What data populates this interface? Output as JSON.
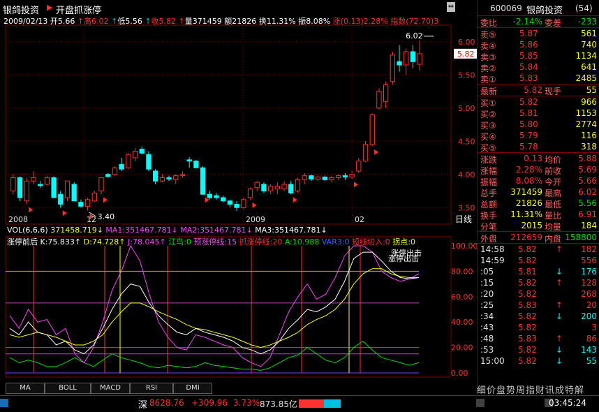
{
  "header": {
    "stock_name": "银鸽投资",
    "marker": "▶",
    "strategy": "开盘抓涨停"
  },
  "quote_line": {
    "date": "2009/02/13",
    "open": "开5.66",
    "high": "高6.02",
    "low": "低5.56",
    "close": "收5.82",
    "volume": "量371459",
    "amount": "额21826",
    "turnover": "换11.31%",
    "amplitude": "振8.08%",
    "change": "涨(0.13)2.28%",
    "index": "指数(72.70)3"
  },
  "chart_data": {
    "type": "candlestick",
    "price_axis": [
      6.0,
      5.5,
      5.0,
      4.5,
      4.0,
      3.5
    ],
    "current_price_tag": "5.82",
    "high_label": "6.02",
    "low_label": "3.40",
    "x_labels": [
      "2008",
      "12",
      "2009",
      "02"
    ],
    "candles": [
      {
        "o": 3.75,
        "h": 4.0,
        "l": 3.7,
        "c": 3.95,
        "up": true
      },
      {
        "o": 3.95,
        "h": 3.97,
        "l": 3.6,
        "c": 3.65,
        "up": false
      },
      {
        "o": 3.6,
        "h": 3.95,
        "l": 3.55,
        "c": 3.9,
        "up": true
      },
      {
        "o": 3.9,
        "h": 4.05,
        "l": 3.85,
        "c": 3.95,
        "up": true
      },
      {
        "o": 3.85,
        "h": 3.9,
        "l": 3.8,
        "c": 3.83,
        "up": false
      },
      {
        "o": 3.85,
        "h": 3.98,
        "l": 3.83,
        "c": 3.95,
        "up": true
      },
      {
        "o": 3.95,
        "h": 3.97,
        "l": 3.65,
        "c": 3.65,
        "up": false
      },
      {
        "o": 3.7,
        "h": 3.75,
        "l": 3.5,
        "c": 3.55,
        "up": false
      },
      {
        "o": 3.65,
        "h": 3.9,
        "l": 3.6,
        "c": 3.9,
        "up": true
      },
      {
        "o": 3.85,
        "h": 3.88,
        "l": 3.6,
        "c": 3.6,
        "up": false
      },
      {
        "o": 3.58,
        "h": 3.62,
        "l": 3.5,
        "c": 3.52,
        "up": false
      },
      {
        "o": 3.52,
        "h": 3.65,
        "l": 3.45,
        "c": 3.62,
        "up": true
      },
      {
        "o": 3.6,
        "h": 3.75,
        "l": 3.58,
        "c": 3.72,
        "up": true
      },
      {
        "o": 3.75,
        "h": 3.95,
        "l": 3.7,
        "c": 3.95,
        "up": true
      },
      {
        "o": 4.0,
        "h": 4.02,
        "l": 3.95,
        "c": 3.97,
        "up": false
      },
      {
        "o": 4.0,
        "h": 4.12,
        "l": 3.98,
        "c": 4.1,
        "up": true
      },
      {
        "o": 4.15,
        "h": 4.25,
        "l": 4.05,
        "c": 4.08,
        "up": false
      },
      {
        "o": 4.1,
        "h": 4.32,
        "l": 4.08,
        "c": 4.3,
        "up": true
      },
      {
        "o": 4.25,
        "h": 4.4,
        "l": 4.2,
        "c": 4.35,
        "up": true
      },
      {
        "o": 4.38,
        "h": 4.42,
        "l": 4.3,
        "c": 4.32,
        "up": false
      },
      {
        "o": 4.3,
        "h": 4.35,
        "l": 4.05,
        "c": 4.08,
        "up": false
      },
      {
        "o": 4.05,
        "h": 4.08,
        "l": 3.85,
        "c": 3.9,
        "up": false
      },
      {
        "o": 3.9,
        "h": 4.0,
        "l": 3.88,
        "c": 3.95,
        "up": true
      },
      {
        "o": 3.95,
        "h": 3.98,
        "l": 3.9,
        "c": 3.93,
        "up": false
      },
      {
        "o": 3.92,
        "h": 4.0,
        "l": 3.85,
        "c": 3.98,
        "up": true
      },
      {
        "o": 3.98,
        "h": 4.05,
        "l": 3.95,
        "c": 4.0,
        "up": true
      },
      {
        "o": 4.22,
        "h": 4.26,
        "l": 4.1,
        "c": 4.2,
        "up": false
      },
      {
        "o": 4.2,
        "h": 4.22,
        "l": 4.1,
        "c": 4.1,
        "up": false
      },
      {
        "o": 4.1,
        "h": 4.12,
        "l": 3.7,
        "c": 3.7,
        "up": false
      },
      {
        "o": 3.7,
        "h": 3.75,
        "l": 3.62,
        "c": 3.65,
        "up": false
      },
      {
        "o": 3.68,
        "h": 3.72,
        "l": 3.62,
        "c": 3.65,
        "up": false
      },
      {
        "o": 3.65,
        "h": 3.68,
        "l": 3.58,
        "c": 3.6,
        "up": false
      },
      {
        "o": 3.6,
        "h": 3.62,
        "l": 3.5,
        "c": 3.55,
        "up": false
      },
      {
        "o": 3.55,
        "h": 3.6,
        "l": 3.45,
        "c": 3.5,
        "up": false
      },
      {
        "o": 3.5,
        "h": 3.65,
        "l": 3.48,
        "c": 3.62,
        "up": true
      },
      {
        "o": 3.65,
        "h": 3.8,
        "l": 3.62,
        "c": 3.78,
        "up": true
      },
      {
        "o": 3.8,
        "h": 3.9,
        "l": 3.75,
        "c": 3.88,
        "up": true
      },
      {
        "o": 3.85,
        "h": 3.88,
        "l": 3.72,
        "c": 3.75,
        "up": false
      },
      {
        "o": 3.75,
        "h": 3.85,
        "l": 3.7,
        "c": 3.82,
        "up": true
      },
      {
        "o": 3.82,
        "h": 3.88,
        "l": 3.7,
        "c": 3.78,
        "up": true
      },
      {
        "o": 3.78,
        "h": 3.9,
        "l": 3.75,
        "c": 3.85,
        "up": true
      },
      {
        "o": 3.85,
        "h": 3.9,
        "l": 3.7,
        "c": 3.72,
        "up": false
      },
      {
        "o": 3.75,
        "h": 3.95,
        "l": 3.72,
        "c": 3.92,
        "up": true
      },
      {
        "o": 3.92,
        "h": 4.02,
        "l": 3.85,
        "c": 3.98,
        "up": true
      },
      {
        "o": 3.98,
        "h": 4.0,
        "l": 3.9,
        "c": 3.93,
        "up": false
      },
      {
        "o": 3.93,
        "h": 3.98,
        "l": 3.9,
        "c": 3.96,
        "up": true
      },
      {
        "o": 3.96,
        "h": 3.98,
        "l": 3.9,
        "c": 3.92,
        "up": false
      },
      {
        "o": 3.92,
        "h": 3.98,
        "l": 3.88,
        "c": 3.95,
        "up": true
      },
      {
        "o": 3.95,
        "h": 4.0,
        "l": 3.92,
        "c": 3.98,
        "up": true
      },
      {
        "o": 3.98,
        "h": 4.02,
        "l": 3.92,
        "c": 3.96,
        "up": false
      },
      {
        "o": 3.96,
        "h": 4.05,
        "l": 3.93,
        "c": 4.0,
        "up": true
      },
      {
        "o": 4.05,
        "h": 4.25,
        "l": 4.02,
        "c": 4.2,
        "up": true
      },
      {
        "o": 4.2,
        "h": 4.5,
        "l": 4.18,
        "c": 4.45,
        "up": true
      },
      {
        "o": 4.45,
        "h": 4.92,
        "l": 4.42,
        "c": 4.9,
        "up": true
      },
      {
        "o": 5.0,
        "h": 5.3,
        "l": 4.98,
        "c": 5.25,
        "up": true
      },
      {
        "o": 5.1,
        "h": 5.4,
        "l": 5.0,
        "c": 5.35,
        "up": true
      },
      {
        "o": 5.4,
        "h": 5.85,
        "l": 5.35,
        "c": 5.8,
        "up": true
      },
      {
        "o": 5.7,
        "h": 5.95,
        "l": 5.55,
        "c": 5.65,
        "up": false
      },
      {
        "o": 5.65,
        "h": 5.9,
        "l": 5.5,
        "c": 5.85,
        "up": true
      },
      {
        "o": 5.85,
        "h": 5.95,
        "l": 5.6,
        "c": 5.7,
        "up": false
      },
      {
        "o": 5.66,
        "h": 6.02,
        "l": 5.56,
        "c": 5.82,
        "up": true
      }
    ],
    "buy_signals": [
      2,
      7,
      11,
      13,
      28,
      35,
      41,
      50,
      53
    ]
  },
  "indicator_bar": {
    "vol": "VOL(6,6,6)",
    "vol_value": "371458.719",
    "ma1": "MA1:351467.781",
    "ma2": "MA2:351467.781",
    "ma3": "MA3:351467.781"
  },
  "kdj_bar": {
    "name": "涨停前后",
    "k": "K:75.833",
    "d": "D:74.728",
    "j": "J:78.045",
    "a": "江鸟:0",
    "b": "预涨停线:15",
    "c": "抓涨停线:20",
    "d2": "A:10.988",
    "e": "VAR3:0",
    "f": "短线切入:0",
    "g": "拐点:0"
  },
  "indicator_axis": [
    "100.00",
    "80.00",
    "60.00",
    "40.00",
    "20.00",
    "0.00"
  ],
  "indicator_notes": [
    "涨停出击",
    "涨停出击"
  ],
  "indicator_lines": {
    "k": [
      35,
      30,
      40,
      32,
      30,
      22,
      25,
      18,
      15,
      22,
      35,
      50,
      62,
      70,
      68,
      55,
      45,
      38,
      32,
      30,
      35,
      32,
      30,
      28,
      25,
      20,
      18,
      15,
      18,
      25,
      35,
      42,
      50,
      48,
      52,
      58,
      72,
      90,
      95,
      95,
      88,
      80,
      75,
      74,
      75
    ],
    "d": [
      30,
      28,
      30,
      32,
      30,
      28,
      25,
      22,
      22,
      25,
      30,
      40,
      48,
      55,
      55,
      52,
      48,
      45,
      42,
      38,
      35,
      34,
      32,
      30,
      28,
      25,
      22,
      20,
      22,
      25,
      28,
      32,
      38,
      42,
      45,
      50,
      58,
      70,
      78,
      82,
      82,
      78,
      76,
      75,
      75
    ],
    "j": [
      45,
      35,
      50,
      40,
      42,
      30,
      35,
      15,
      8,
      20,
      40,
      65,
      80,
      100,
      88,
      62,
      40,
      28,
      20,
      18,
      30,
      28,
      25,
      22,
      20,
      12,
      8,
      5,
      12,
      30,
      48,
      60,
      70,
      58,
      62,
      75,
      92,
      105,
      100,
      95,
      80,
      75,
      72,
      74,
      78
    ],
    "a": [
      12,
      8,
      10,
      8,
      5,
      5,
      8,
      12,
      8,
      5,
      10,
      15,
      12,
      10,
      8,
      5,
      4,
      6,
      5,
      4,
      5,
      8,
      6,
      5,
      4,
      3,
      3,
      2,
      4,
      8,
      12,
      14,
      20,
      15,
      10,
      8,
      12,
      20,
      25,
      18,
      12,
      10,
      8,
      6,
      8
    ]
  },
  "right_panel": {
    "code": "600069",
    "name": "银鸽投资",
    "count": "(54)",
    "ratio_label": "委比",
    "ratio_value": "-2.14%",
    "diff_label": "委差",
    "diff_value": "-233",
    "sells": [
      {
        "label": "卖⑤",
        "price": "5.87",
        "vol": "561"
      },
      {
        "label": "卖④",
        "price": "5.86",
        "vol": "740"
      },
      {
        "label": "卖③",
        "price": "5.85",
        "vol": "1134"
      },
      {
        "label": "卖②",
        "price": "5.84",
        "vol": "641"
      },
      {
        "label": "卖①",
        "price": "5.83",
        "vol": "2485"
      }
    ],
    "last_label": "最新",
    "last_value": "5.82",
    "hand_label": "现手",
    "hand_value": "55",
    "buys": [
      {
        "label": "买①",
        "price": "5.82",
        "vol": "966"
      },
      {
        "label": "买②",
        "price": "5.81",
        "vol": "1153"
      },
      {
        "label": "买③",
        "price": "5.80",
        "vol": "2774"
      },
      {
        "label": "买④",
        "price": "5.79",
        "vol": "116"
      },
      {
        "label": "买⑤",
        "price": "5.78",
        "vol": "318"
      }
    ],
    "stats": [
      {
        "l1": "涨跌",
        "v1": "0.13",
        "l2": "均价",
        "v2": "5.88"
      },
      {
        "l1": "涨幅",
        "v1": "2.28%",
        "l2": "前收",
        "v2": "5.69"
      },
      {
        "l1": "振幅",
        "v1": "8.08%",
        "l2": "今开",
        "v2": "5.66"
      },
      {
        "l1": "总手",
        "v1": "371459",
        "l2": "最高",
        "v2": "6.02"
      },
      {
        "l1": "总额",
        "v1": "21826",
        "l2": "最低",
        "v2": "5.56"
      },
      {
        "l1": "换手",
        "v1": "11.31%",
        "l2": "量比",
        "v2": "6.91"
      },
      {
        "l1": "分笔",
        "v1": "2015",
        "l2": "均量",
        "v2": "184"
      }
    ],
    "outer_label": "外盘",
    "outer_value": "212659",
    "inner_label": "内盘",
    "inner_value": "158800",
    "ticks": [
      {
        "t": "14:58",
        "p": "5.82",
        "a": "↑",
        "v": "182"
      },
      {
        "t": "14:59",
        "p": "5.82",
        "a": "",
        "v": "556"
      },
      {
        "t": ":05",
        "p": "5.81",
        "a": "↓",
        "v": "176"
      },
      {
        "t": ":15",
        "p": "5.82",
        "a": "↑",
        "v": "128"
      },
      {
        "t": ":20",
        "p": "5.82",
        "a": "",
        "v": "268"
      },
      {
        "t": ":25",
        "p": "5.83",
        "a": "↑",
        "v": "20"
      },
      {
        "t": ":34",
        "p": "5.82",
        "a": "↓",
        "v": "200"
      },
      {
        "t": ":43",
        "p": "5.82",
        "a": "",
        "v": "3"
      },
      {
        "t": ":48",
        "p": "5.83",
        "a": "↑",
        "v": "86"
      },
      {
        "t": ":53",
        "p": "5.82",
        "a": "↓",
        "v": "143"
      },
      {
        "t": "15:00",
        "p": "5.82",
        "a": "↓",
        "v": "55"
      }
    ],
    "nav": "细价盘势周指财讯成特解"
  },
  "tabs": [
    "MA",
    "BOLL",
    "MACD",
    "RSI",
    "DMI"
  ],
  "status_bar": {
    "market": "深",
    "index": "8628.76",
    "change": "+309.96",
    "pct": "3.73%",
    "amount": "873.85亿",
    "time": "03:45:24"
  },
  "colors": {
    "up": "#ff3030",
    "down": "#00ffff",
    "grid": "#800000",
    "ma_yellow": "#ffff00",
    "k_white": "#ffffff",
    "j_magenta": "#ff40ff",
    "a_green": "#00e000"
  }
}
